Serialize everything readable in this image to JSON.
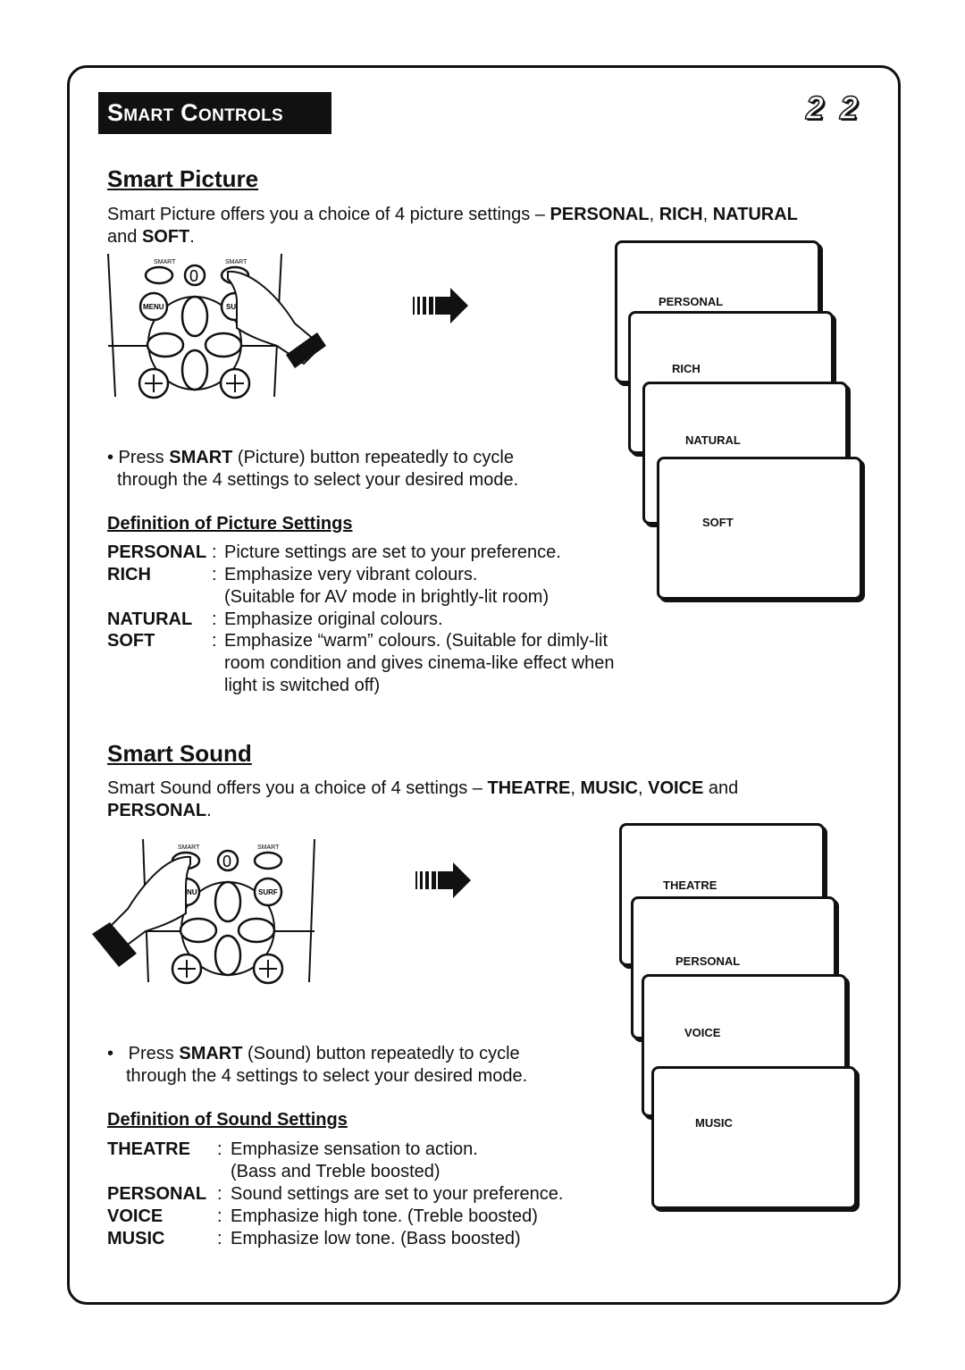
{
  "header": {
    "section_title": "Smart Controls",
    "page_number": "2 2"
  },
  "picture": {
    "title": "Smart Picture",
    "intro": {
      "text": "Smart Picture offers you a choice of 4 picture settings – ",
      "b1": "PERSONAL",
      "s1": ", ",
      "b2": "RICH",
      "s2": ", ",
      "b3": "NATURAL",
      "line2_pre": "and ",
      "b4": "SOFT",
      "line2_post": "."
    },
    "remote": {
      "smart_left": "SMART",
      "smart_right": "SMART",
      "zero": "0",
      "menu": "MENU",
      "surf": "SUR"
    },
    "bullet": {
      "pre": "• Press ",
      "bold": "SMART",
      "post": " (Picture) button repeatedly to cycle",
      "line2": "through the 4 settings to select your desired mode."
    },
    "def_title": "Definition of Picture Settings",
    "defs": [
      {
        "term": "PERSONAL",
        "colon": ":",
        "lines": [
          "Picture settings are set to your preference."
        ]
      },
      {
        "term": "RICH",
        "colon": ":",
        "lines": [
          "Emphasize very vibrant colours.",
          "(Suitable for AV mode in brightly-lit room)"
        ]
      },
      {
        "term": "NATURAL",
        "colon": ":",
        "lines": [
          "Emphasize original colours."
        ]
      },
      {
        "term": "SOFT",
        "colon": ":",
        "lines": [
          "Emphasize “warm” colours. (Suitable for dimly-lit",
          "room condition and gives cinema-like effect when",
          "light is switched off)"
        ]
      }
    ],
    "screens": [
      "PERSONAL",
      "RICH",
      "NATURAL",
      "SOFT"
    ]
  },
  "sound": {
    "title": "Smart Sound",
    "intro": {
      "text": "Smart Sound offers you a choice of 4 settings – ",
      "b1": "THEATRE",
      "s1": ", ",
      "b2": "MUSIC",
      "s2": ", ",
      "b3": "VOICE",
      "s3": " and",
      "b4": "PERSONAL",
      "post": "."
    },
    "remote": {
      "smart_left": "SMART",
      "smart_right": "SMART",
      "zero": "0",
      "menu": "MENU",
      "surf": "SURF"
    },
    "bullet": {
      "pre": "•   Press ",
      "bold": "SMART",
      "post": " (Sound) button repeatedly to cycle",
      "line2": "through the 4 settings to select your desired mode."
    },
    "def_title": "Definition of Sound Settings",
    "defs": [
      {
        "term": "THEATRE",
        "colon": ":",
        "lines": [
          "Emphasize sensation to action.",
          "(Bass and Treble boosted)"
        ]
      },
      {
        "term": "PERSONAL",
        "colon": ":",
        "lines": [
          "Sound settings are set to your preference."
        ]
      },
      {
        "term": "VOICE",
        "colon": ":",
        "lines": [
          "Emphasize high tone. (Treble boosted)"
        ]
      },
      {
        "term": "MUSIC",
        "colon": ":",
        "lines": [
          "Emphasize low tone. (Bass boosted)"
        ]
      }
    ],
    "screens": [
      "THEATRE",
      "PERSONAL",
      "VOICE",
      "MUSIC"
    ]
  }
}
